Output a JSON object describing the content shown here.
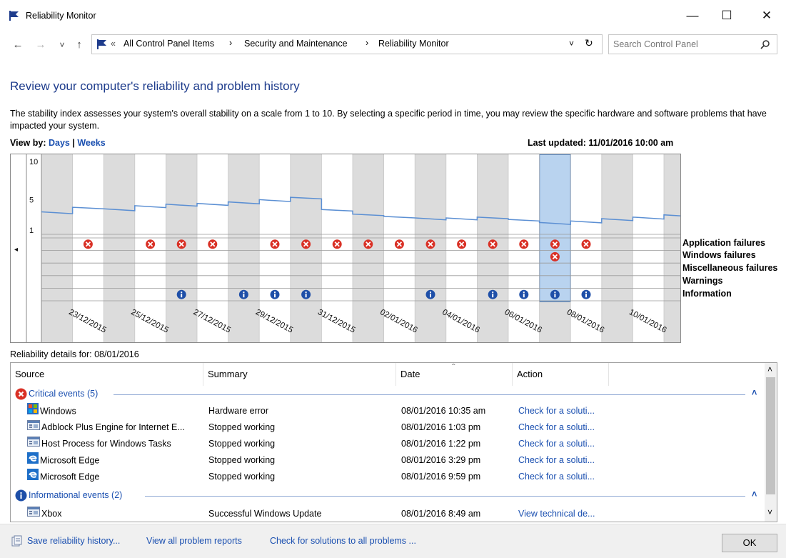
{
  "window": {
    "title": "Reliability Monitor",
    "minimize": "—",
    "maximize": "☐",
    "close": "✕"
  },
  "nav": {
    "back": "←",
    "forward": "→",
    "recent": "˅",
    "up": "↑",
    "breadcrumb_prefix": "«",
    "breadcrumb": [
      "All Control Panel Items",
      "Security and Maintenance",
      "Reliability Monitor"
    ],
    "separator": "›",
    "dropdown": "˅",
    "refresh": "↻",
    "search_placeholder": "Search Control Panel"
  },
  "page": {
    "heading": "Review your computer's reliability and problem history",
    "description": "The stability index assesses your system's overall stability on a scale from 1 to 10. By selecting a specific period in time, you may review the specific hardware and software problems that have impacted your system.",
    "view_by_label": "View by:",
    "view_days": "Days",
    "view_sep": "|",
    "view_weeks": "Weeks",
    "last_updated": "Last updated: 11/01/2016 10:00 am"
  },
  "chart_data": {
    "type": "line",
    "y_ticks": [
      "10",
      "5",
      "1"
    ],
    "ylim": [
      1,
      10
    ],
    "date_labels": [
      "23/12/2015",
      "25/12/2015",
      "27/12/2015",
      "29/12/2015",
      "31/12/2015",
      "02/01/2016",
      "04/01/2016",
      "06/01/2016",
      "08/01/2016",
      "10/01/2016"
    ],
    "selected_column": 16,
    "stability_index": [
      3.3,
      3.9,
      3.7,
      4.1,
      4.3,
      4.4,
      4.6,
      4.9,
      5.2,
      3.6,
      3.0,
      2.7,
      2.5,
      2.5,
      2.6,
      2.3,
      1.9,
      2.1,
      2.4,
      2.6,
      2.9,
      3.1
    ],
    "rows": [
      "Application failures",
      "Windows failures",
      "Miscellaneous failures",
      "Warnings",
      "Information"
    ],
    "app_failure_days": [
      1,
      3,
      4,
      5,
      7,
      8,
      9,
      10,
      11,
      12,
      13,
      14,
      15,
      16,
      17
    ],
    "windows_failure_days": [
      16
    ],
    "information_days": [
      4,
      6,
      7,
      8,
      12,
      14,
      15,
      16,
      17
    ],
    "scroll_left": "◂",
    "scroll_right": "▸"
  },
  "details": {
    "label": "Reliability details for: 08/01/2016",
    "columns": [
      "Source",
      "Summary",
      "Date",
      "Action"
    ],
    "sort_indicator": "ˆ",
    "groups": [
      {
        "title": "Critical events (5)",
        "collapse": "˄",
        "rows": [
          {
            "icon": "windows-flag-icon",
            "source": "Windows",
            "summary": "Hardware error",
            "date": "08/01/2016 10:35 am",
            "action": "Check for a soluti..."
          },
          {
            "icon": "app-window-icon",
            "source": "Adblock Plus Engine for Internet E...",
            "summary": "Stopped working",
            "date": "08/01/2016 1:03 pm",
            "action": "Check for a soluti..."
          },
          {
            "icon": "app-window-icon",
            "source": "Host Process for Windows Tasks",
            "summary": "Stopped working",
            "date": "08/01/2016 1:22 pm",
            "action": "Check for a soluti..."
          },
          {
            "icon": "edge-icon",
            "source": "Microsoft Edge",
            "summary": "Stopped working",
            "date": "08/01/2016 3:29 pm",
            "action": "Check for a soluti..."
          },
          {
            "icon": "edge-icon",
            "source": "Microsoft Edge",
            "summary": "Stopped working",
            "date": "08/01/2016 9:59 pm",
            "action": "Check for a soluti..."
          }
        ]
      },
      {
        "title": "Informational events (2)",
        "collapse": "˄",
        "rows": [
          {
            "icon": "app-window-icon",
            "source": "Xbox",
            "summary": "Successful Windows Update",
            "date": "08/01/2016 8:49 am",
            "action": "View technical de..."
          }
        ]
      }
    ],
    "scroll_up": "˄",
    "scroll_down": "˅"
  },
  "footer": {
    "save_history": "Save reliability history...",
    "view_reports": "View all problem reports",
    "check_solutions": "Check for solutions to all problems ...",
    "ok": "OK"
  },
  "colors": {
    "accent": "#1e3c8c",
    "link": "#1a4fb0",
    "error": "#d93025",
    "info": "#1e4fa8",
    "line": "#5b8fd3",
    "selection": "#b9d3ef"
  }
}
